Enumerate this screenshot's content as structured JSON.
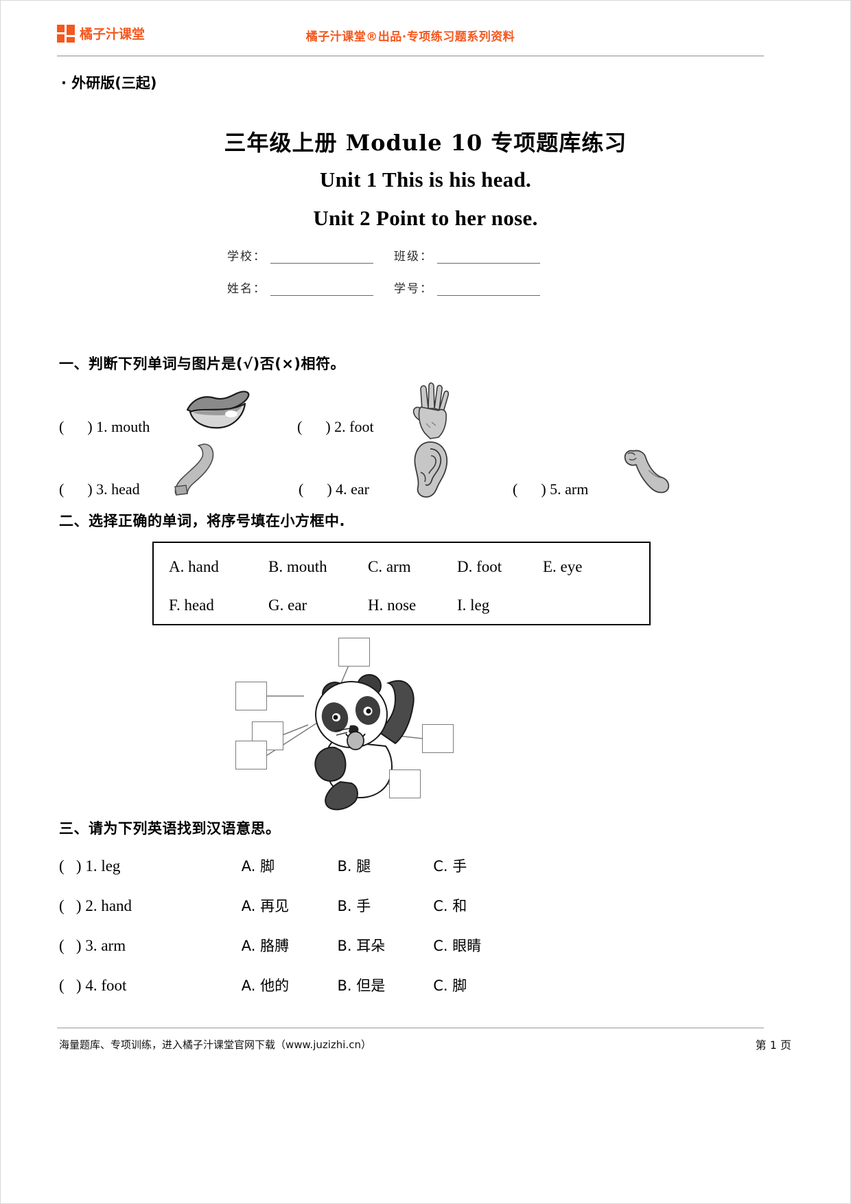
{
  "header": {
    "logo_text": "橘子汁课堂",
    "center_text": "橘子汁课堂®出品·专项练习题系列资料",
    "brand_color": "#F4581F"
  },
  "edition": "· 外研版(三起)",
  "titles": {
    "main": "三年级上册 Module 10 专项题库练习",
    "unit1": "Unit 1 This is his head.",
    "unit2": "Unit 2 Point to her nose."
  },
  "info_fields": {
    "school_label": "学校：",
    "class_label": "班级：",
    "name_label": "姓名：",
    "number_label": "学号："
  },
  "section1": {
    "heading": "一、判断下列单词与图片是(√)否(×)相符。",
    "items": [
      {
        "num": "1.",
        "word": "mouth",
        "picture": "lips-mouth-icon"
      },
      {
        "num": "2.",
        "word": "foot",
        "picture": "open-hand-icon"
      },
      {
        "num": "3.",
        "word": "head",
        "picture": "bent-leg-icon"
      },
      {
        "num": "4.",
        "word": "ear",
        "picture": "ear-icon"
      },
      {
        "num": "5.",
        "word": "arm",
        "picture": "flexed-arm-icon"
      }
    ]
  },
  "section2": {
    "heading": "二、选择正确的单词，将序号填在小方框中.",
    "word_bank_row1": [
      "A. hand",
      "B. mouth",
      "C. arm",
      "D. foot",
      "E. eye"
    ],
    "word_bank_row2": [
      "F. head",
      "G. ear",
      "H. nose",
      "I. leg"
    ],
    "diagram": {
      "image": "panda-cartoon",
      "label_boxes": 6
    }
  },
  "section3": {
    "heading": "三、请为下列英语找到汉语意思。",
    "items": [
      {
        "num": "1.",
        "word": "leg",
        "a": "A. 脚",
        "b": "B. 腿",
        "c": "C. 手"
      },
      {
        "num": "2.",
        "word": "hand",
        "a": "A. 再见",
        "b": "B. 手",
        "c": "C. 和"
      },
      {
        "num": "3.",
        "word": "arm",
        "a": "A. 胳膊",
        "b": "B. 耳朵",
        "c": "C. 眼睛"
      },
      {
        "num": "4.",
        "word": "foot",
        "a": "A. 他的",
        "b": "B. 但是",
        "c": "C. 脚"
      }
    ]
  },
  "footer": {
    "left": "海量题库、专项训练，进入橘子汁课堂官网下载（www.juzizhi.cn）",
    "right": "第 1 页"
  }
}
